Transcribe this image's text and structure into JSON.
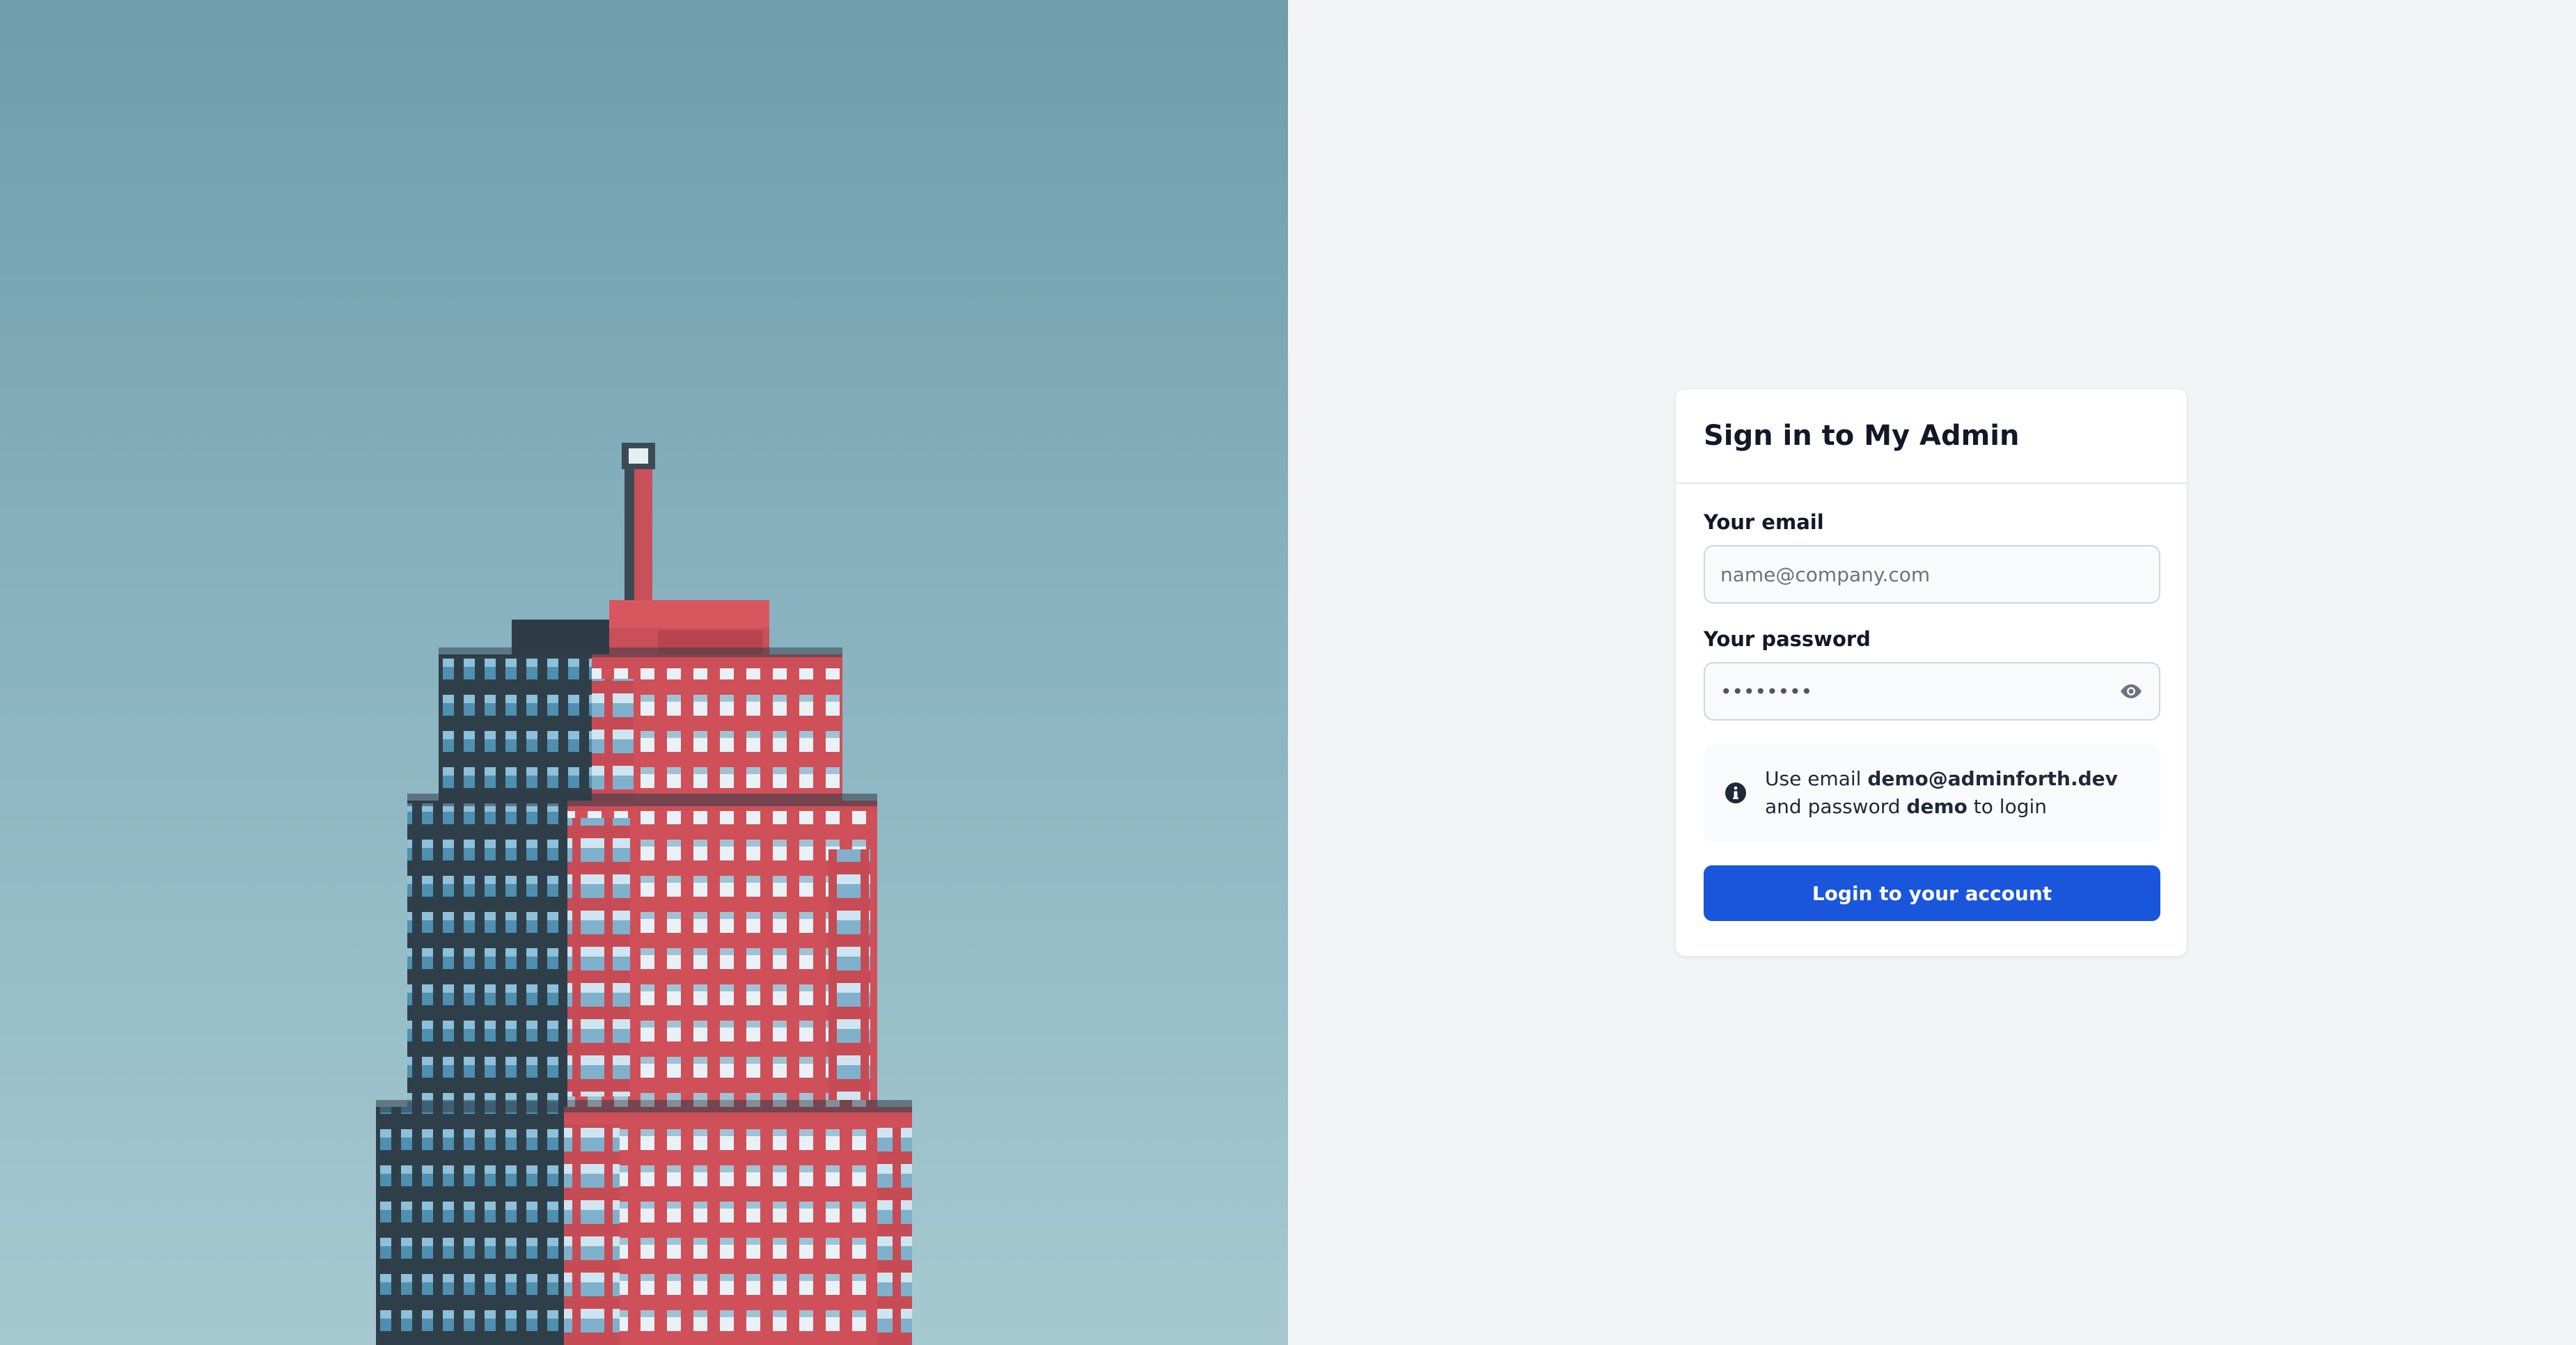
{
  "login": {
    "title": "Sign in to My Admin",
    "email_label": "Your email",
    "email_placeholder": "name@company.com",
    "password_label": "Your password",
    "password_value": "••••••••",
    "info": {
      "prefix": "Use email ",
      "email": "demo@adminforth.dev",
      "middle": " and password ",
      "password": "demo",
      "suffix": " to login"
    },
    "submit_label": "Login to your account"
  },
  "icons": {
    "password_toggle": "eye-icon",
    "info": "info-circle-icon"
  },
  "colors": {
    "primary_button": "#1a56db",
    "page_background": "#f3f4f6",
    "building": "#d9545f",
    "sky_top": "#6e9dac",
    "sky_bottom": "#a6c9d1"
  }
}
